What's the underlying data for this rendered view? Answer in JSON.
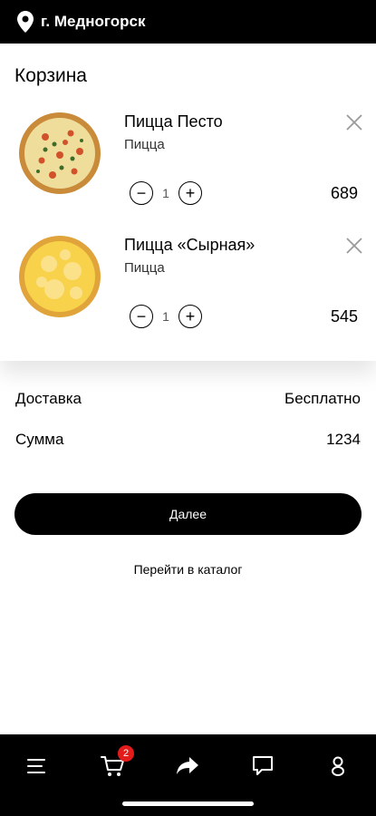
{
  "location": {
    "city": "г. Медногорск"
  },
  "cart": {
    "title": "Корзина",
    "items": [
      {
        "name": "Пицца Песто",
        "category": "Пицца",
        "quantity": "1",
        "price": "689"
      },
      {
        "name": "Пицца «Сырная»",
        "category": "Пицца",
        "quantity": "1",
        "price": "545"
      }
    ]
  },
  "summary": {
    "delivery_label": "Доставка",
    "delivery_value": "Бесплатно",
    "sum_label": "Сумма",
    "sum_value": "1234"
  },
  "actions": {
    "next_label": "Далее",
    "catalog_label": "Перейти в каталог"
  },
  "bottom_nav": {
    "items": [
      "menu-icon",
      "cart-icon",
      "share-icon",
      "chat-icon",
      "profile-icon"
    ],
    "cart_badge": "2"
  },
  "colors": {
    "bar": "#000000",
    "badge": "#e31b1b",
    "background": "#ffffff"
  }
}
